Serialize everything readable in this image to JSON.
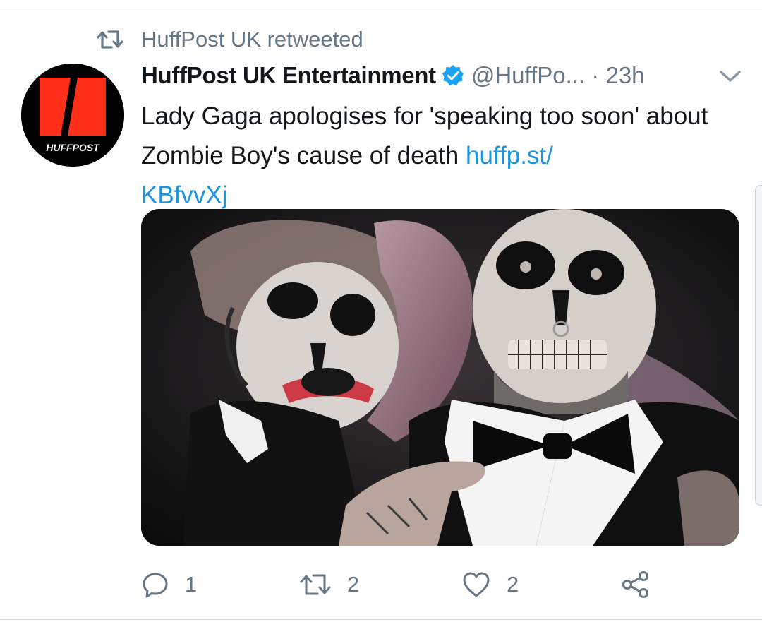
{
  "retweet_context": {
    "text": "HuffPost UK retweeted"
  },
  "avatar": {
    "logo_text": "HUFFPOST",
    "brand_red": "#ff2f1a"
  },
  "tweet": {
    "author_name": "HuffPost UK Entertainment",
    "verified": true,
    "handle": "@HuffPo...",
    "separator": " · ",
    "timestamp": "23h",
    "text_before_link": "Lady Gaga apologises for 'speaking too soon' about Zombie Boy's cause of death ",
    "link_text": "huffp.st/",
    "link_text_2": "KBfvvXj"
  },
  "media": {
    "description_icon": "photo"
  },
  "actions": {
    "reply_count": "1",
    "retweet_count": "2",
    "like_count": "2"
  },
  "colors": {
    "accent": "#1b95e0",
    "secondary_text": "#657786",
    "divider": "#d5dde3",
    "verified_badge": "#1da1f2"
  },
  "icons": [
    "retweet-icon",
    "verified-badge-icon",
    "caret-down-icon",
    "reply-icon",
    "retweet-icon",
    "like-icon",
    "share-icon"
  ]
}
